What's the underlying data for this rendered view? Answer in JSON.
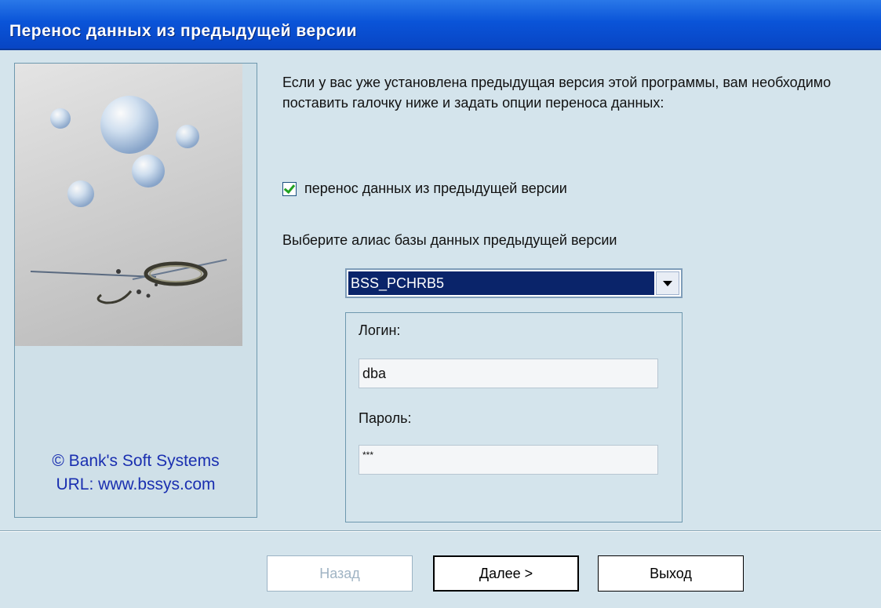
{
  "window": {
    "title": "Перенос данных из предыдущей версии"
  },
  "sidebar": {
    "copyright": "© Bank's Soft Systems",
    "url": "URL: www.bssys.com"
  },
  "main": {
    "intro": "Если у вас уже установлена предыдущая версия этой программы, вам необходимо поставить галочку ниже и задать опции переноса данных:",
    "checkbox_label": "перенос данных из предыдущей версии",
    "checkbox_checked": true,
    "alias_label": "Выберите алиас базы данных предыдущей версии",
    "alias_value": "BSS_PCHRB5",
    "login_label": "Логин:",
    "login_value": "dba",
    "password_label": "Пароль:",
    "password_value": "***"
  },
  "buttons": {
    "back": "Назад",
    "next": "Далее >",
    "exit": "Выход"
  },
  "colors": {
    "titlebar": "#0a54d8",
    "background": "#d4e4ec",
    "selection": "#0a246a",
    "copyright_text": "#1a2fb0"
  }
}
